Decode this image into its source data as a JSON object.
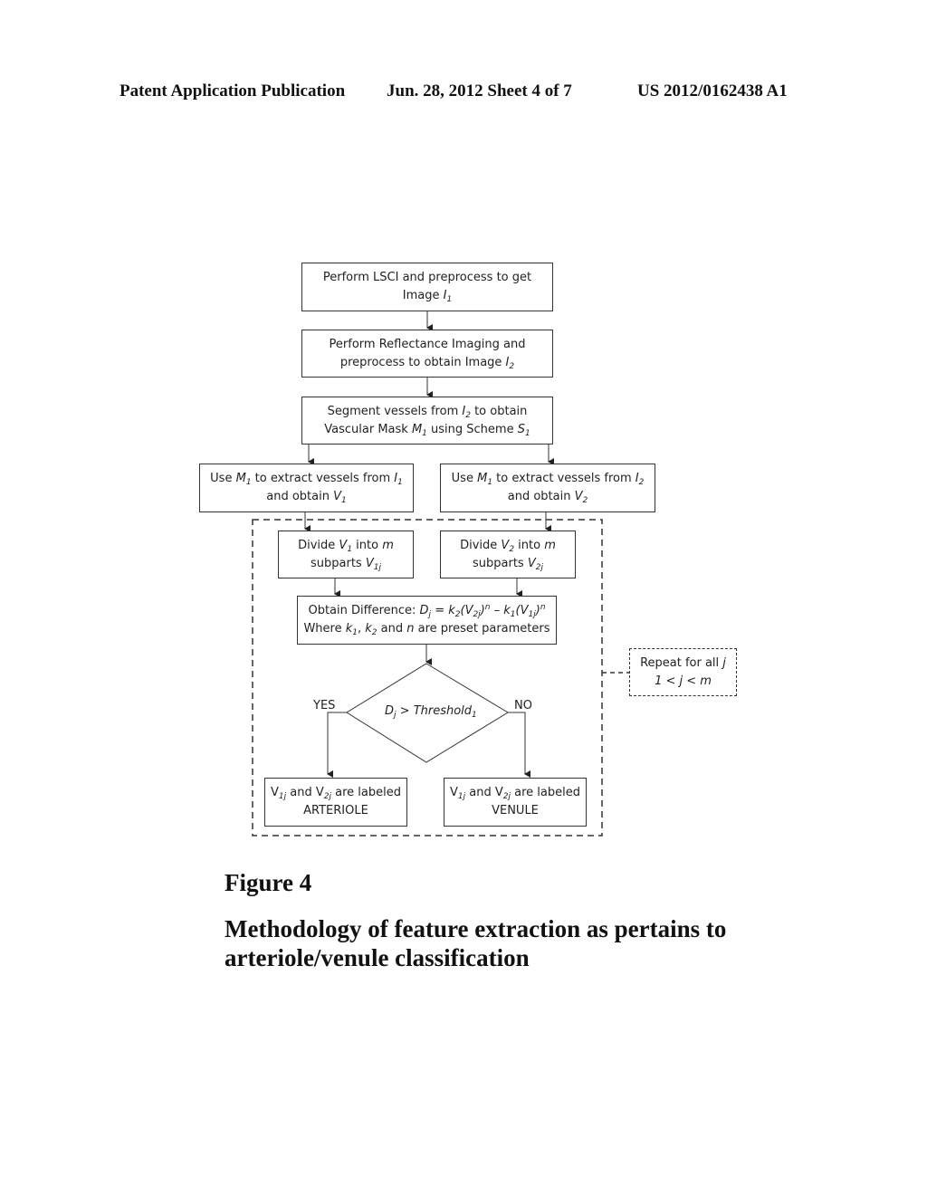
{
  "header": {
    "publication": "Patent Application Publication",
    "date_sheet": "Jun. 28, 2012  Sheet 4 of 7",
    "number": "US 2012/0162438 A1"
  },
  "flowchart": {
    "step1": {
      "line1": "Perform LSCI and preprocess to get",
      "line2_text": "Image ",
      "line2_var": "I",
      "line2_sub": "1"
    },
    "step2": {
      "line1": "Perform Reflectance Imaging and",
      "line2_text": "preprocess to obtain Image ",
      "line2_var": "I",
      "line2_sub": "2"
    },
    "step3": {
      "line1_a": "Segment vessels from ",
      "line1_var": "I",
      "line1_sub": "2",
      "line1_b": " to obtain",
      "line2_a": "Vascular Mask ",
      "line2_var1": "M",
      "line2_sub1": "1",
      "line2_b": " using Scheme ",
      "line2_var2": "S",
      "line2_sub2": "1"
    },
    "step4a": {
      "a": "Use ",
      "var1": "M",
      "sub1": "1",
      "b": " to extract vessels from ",
      "var2": "I",
      "sub2": "1",
      "line2_a": "and obtain ",
      "line2_var": "V",
      "line2_sub": "1"
    },
    "step4b": {
      "a": "Use ",
      "var1": "M",
      "sub1": "1",
      "b": " to extract vessels from ",
      "var2": "I",
      "sub2": "2",
      "line2_a": "and obtain ",
      "line2_var": "V",
      "line2_sub": "2"
    },
    "step5a": {
      "a": "Divide ",
      "var": "V",
      "sub": "1",
      "b": " into ",
      "m": "m",
      "line2_a": "subparts ",
      "line2_var": "V",
      "line2_sub": "1j"
    },
    "step5b": {
      "a": "Divide ",
      "var": "V",
      "sub": "2",
      "b": " into ",
      "m": "m",
      "line2_a": "subparts ",
      "line2_var": "V",
      "line2_sub": "2j"
    },
    "step6": {
      "a": "Obtain Difference: ",
      "formula": {
        "D": "D",
        "Dsub": "j",
        "eq": " = ",
        "k2": "k",
        "k2sub": "2",
        "v2": "(V",
        "v2sub": "2j",
        "close1": ")",
        "n1": "n",
        "minus": " – ",
        "k1": "k",
        "k1sub": "1",
        "v1": "(V",
        "v1sub": "1j",
        "close2": ")",
        "n2": "n"
      },
      "line2_a": "Where ",
      "k1": "k",
      "k1sub": "1",
      "comma": ", ",
      "k2": "k",
      "k2sub": "2",
      "and": " and ",
      "n": "n",
      "line2_b": " are preset parameters"
    },
    "decision": {
      "D": "D",
      "Dsub": "j",
      "op": " > Threshold",
      "tsub": "1",
      "yes": "YES",
      "no": "NO"
    },
    "result_arteriole": {
      "v1": "V",
      "v1sub": "1j",
      "and": " and V",
      "v2sub": "2j",
      "tail": " are labeled",
      "label": "ARTERIOLE"
    },
    "result_venule": {
      "v1": "V",
      "v1sub": "1j",
      "and": " and V",
      "v2sub": "2j",
      "tail": " are labeled",
      "label": "VENULE"
    },
    "repeat": {
      "line1": "Repeat for all ",
      "j": "j",
      "line2": "1 < j < m"
    }
  },
  "figure": {
    "label": "Figure 4",
    "caption_line1": "Methodology of feature extraction as pertains to",
    "caption_line2": "arteriole/venule classification"
  }
}
